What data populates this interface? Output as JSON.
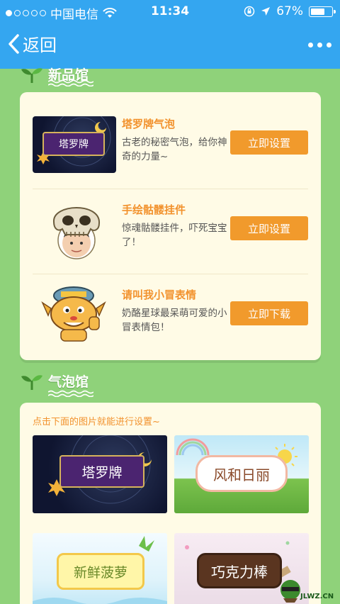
{
  "status": {
    "carrier": "中国电信",
    "time": "11:34",
    "battery": "67%"
  },
  "nav": {
    "back_label": "返回"
  },
  "new_section": {
    "title": "新品馆",
    "items": [
      {
        "name": "塔罗牌气泡",
        "desc": "古老的秘密气泡，给你神奇的力量~",
        "button": "立即设置",
        "thumb_label": "塔罗牌"
      },
      {
        "name": "手绘骷髅挂件",
        "desc": "惊魂骷髅挂件，吓死宝宝了！",
        "button": "立即设置"
      },
      {
        "name": "请叫我小冒表情",
        "desc": "奶酪星球最呆萌可爱的小冒表情包！",
        "button": "立即下载"
      }
    ]
  },
  "bubble_section": {
    "title": "气泡馆",
    "hint": "点击下面的图片就能进行设置~",
    "tiles": [
      {
        "label": "塔罗牌"
      },
      {
        "label": "风和日丽"
      },
      {
        "label": "新鲜菠萝"
      },
      {
        "label": "巧克力棒"
      }
    ]
  },
  "watermark": {
    "text": "JLWZ.CN"
  },
  "colors": {
    "nav": "#34a6f0",
    "bg": "#8fd27a",
    "accent": "#f19a2c",
    "card": "#fffbe6"
  }
}
